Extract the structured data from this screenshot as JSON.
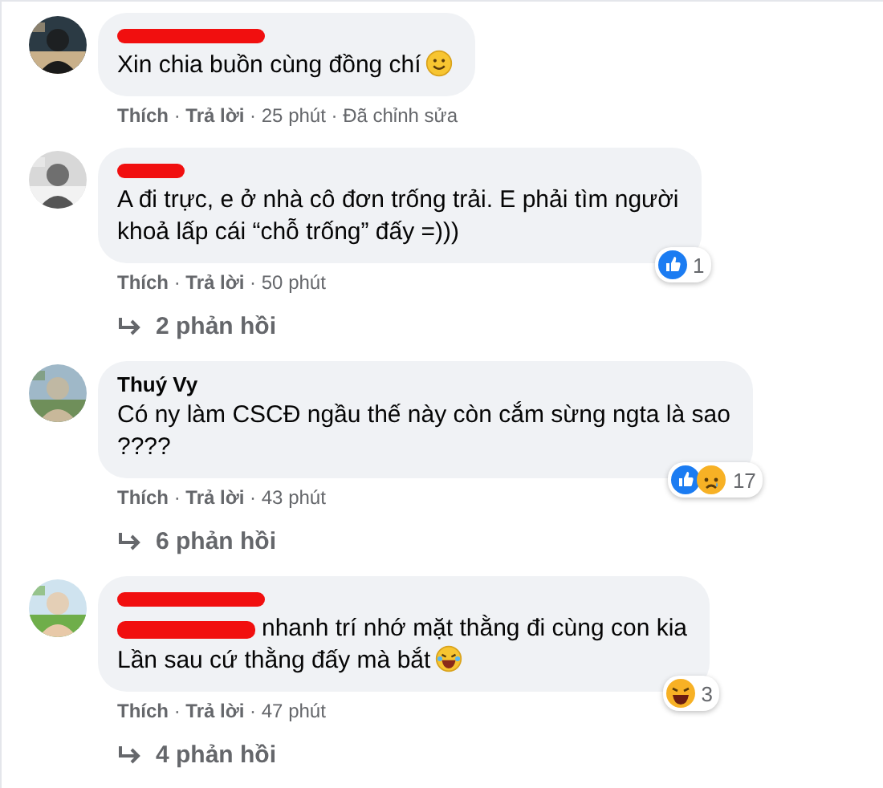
{
  "comments": [
    {
      "author_redacted": true,
      "text": "Xin chia buồn cùng đồng chí",
      "end_icon": {
        "kind": "smile"
      },
      "meta": "**Thích** · **Trả lời** · 25 phút · Đã chỉnh sửa"
    },
    {
      "author_redacted": true,
      "text": "A đi trực, e ở nhà cô đơn trống trải. E phải tìm người\nkhoả lấp cái “chỗ trống” đấy =)))",
      "meta": "**Thích** · **Trả lời** · 50 phút",
      "reactions": {
        "icons": [
          {
            "kind": "like"
          }
        ],
        "count": "1"
      },
      "replies": "2 phản hồi"
    },
    {
      "author": "Thuý Vy",
      "text": "Có ny làm CSCĐ ngầu thế này còn cắm sừng ngta là sao\n????",
      "meta": "**Thích** · **Trả lời** · 43 phút",
      "reactions": {
        "icons": [
          {
            "kind": "like"
          },
          {
            "kind": "sad"
          }
        ],
        "count": "17"
      },
      "replies": "6 phản hồi"
    },
    {
      "author_redacted": true,
      "mention_redacted": true,
      "text": "nhanh trí nhớ mặt thằng đi cùng con kia\nLần sau cứ thằng đấy mà bắt",
      "end_icon": {
        "kind": "laugh"
      },
      "meta": "**Thích** · **Trả lời** · 47 phút",
      "reactions": {
        "icons": [
          {
            "kind": "haha"
          }
        ],
        "count": "3"
      },
      "replies": "4 phản hồi"
    }
  ]
}
